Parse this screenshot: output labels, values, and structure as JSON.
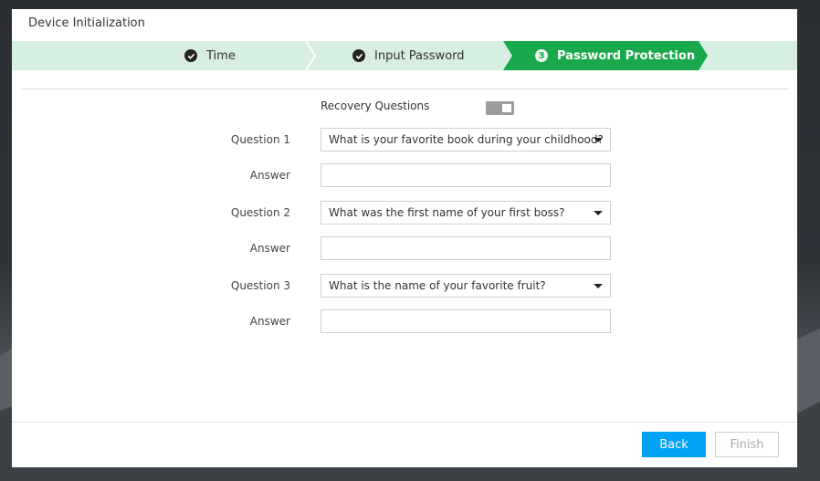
{
  "window": {
    "title": "Device Initialization"
  },
  "steps": [
    {
      "label": "Time",
      "state": "done"
    },
    {
      "label": "Input Password",
      "state": "done"
    },
    {
      "label": "Password Protection",
      "state": "active",
      "number": "3"
    }
  ],
  "form": {
    "recovery_label": "Recovery Questions",
    "recovery_enabled": true,
    "questions": [
      {
        "label": "Question 1",
        "selected": "What is your favorite book during your childhood?",
        "answer_label": "Answer",
        "answer_value": ""
      },
      {
        "label": "Question 2",
        "selected": "What was the first name of your first boss?",
        "answer_label": "Answer",
        "answer_value": ""
      },
      {
        "label": "Question 3",
        "selected": "What is the name of your favorite fruit?",
        "answer_label": "Answer",
        "answer_value": ""
      }
    ]
  },
  "buttons": {
    "back": "Back",
    "finish": "Finish"
  },
  "colors": {
    "accent_green": "#1aa84c",
    "step_bg": "#d7efe1",
    "primary_blue": "#00a2f5"
  }
}
